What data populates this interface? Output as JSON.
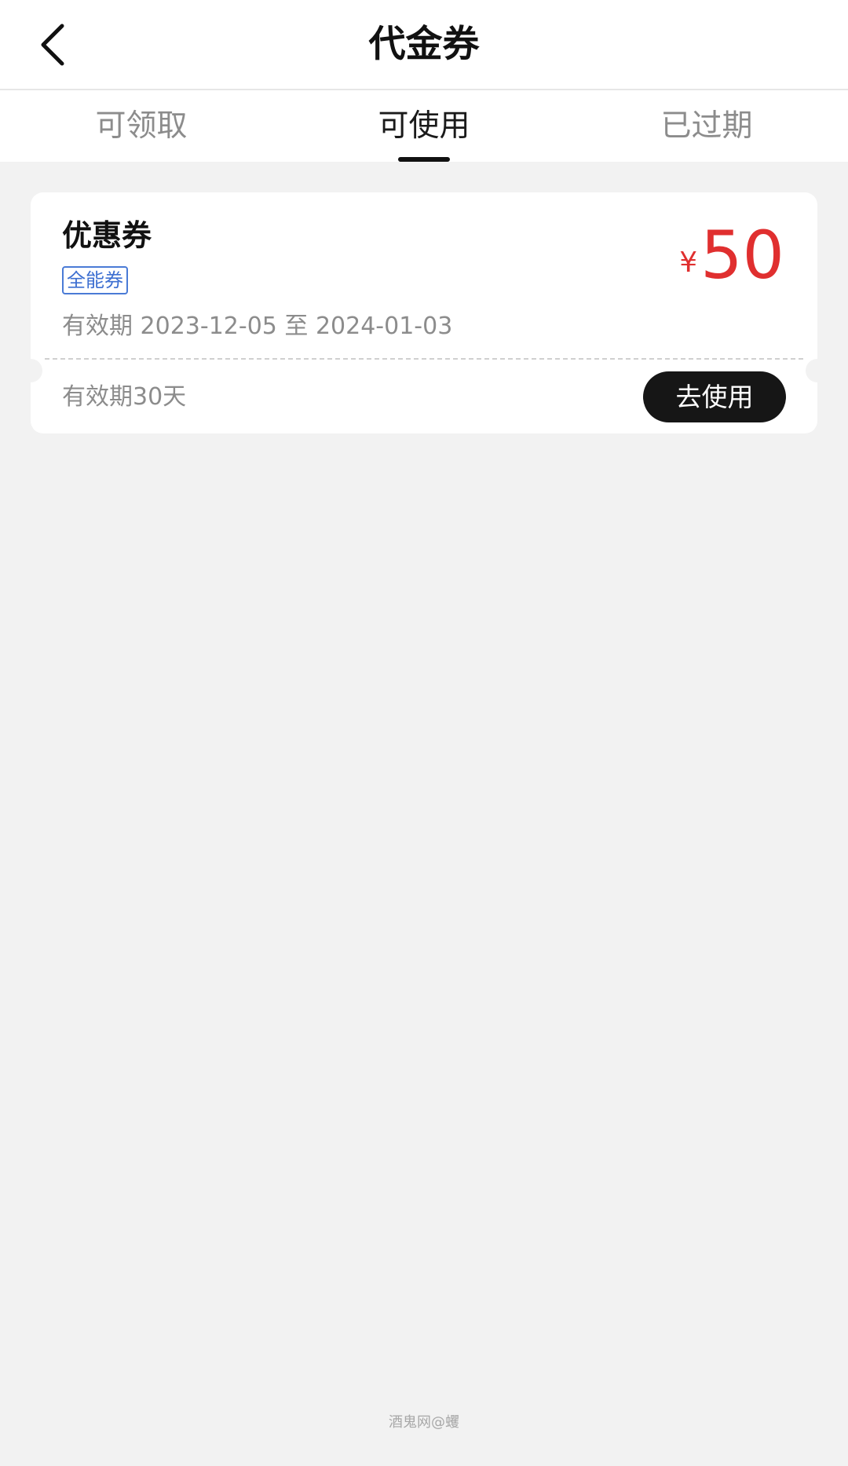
{
  "header": {
    "title": "代金券",
    "back_icon": "chevron-left-icon"
  },
  "tabs": [
    {
      "label": "可领取",
      "active": false
    },
    {
      "label": "可使用",
      "active": true
    },
    {
      "label": "已过期",
      "active": false
    }
  ],
  "coupon": {
    "name": "优惠券",
    "badge": "全能券",
    "validity": "有效期 2023-12-05 至 2024-01-03",
    "currency": "¥",
    "amount": "50",
    "duration": "有效期30天",
    "use_button": "去使用"
  },
  "colors": {
    "amount_red": "#e02f2f",
    "badge_blue": "#3d6fd1",
    "button_black": "#161616",
    "background": "#f2f2f2"
  },
  "watermark": "酒鬼网@蠼"
}
